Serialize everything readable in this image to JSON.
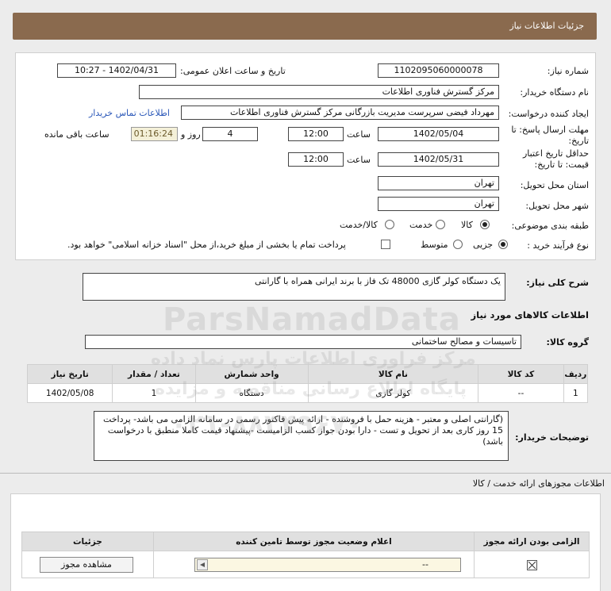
{
  "header": {
    "title": "جزئیات اطلاعات نیاز"
  },
  "form": {
    "need_number_label": "شماره نیاز:",
    "need_number": "1102095060000078",
    "announce_label": "تاریخ و ساعت اعلان عمومی:",
    "announce_value": "1402/04/31 - 10:27",
    "buyer_org_label": "نام دستگاه خریدار:",
    "buyer_org": "مرکز گسترش فناوری اطلاعات",
    "requester_label": "ایجاد کننده درخواست:",
    "requester": "مهرداد فیضی سرپرست مدیریت بازرگانی مرکز گسترش فناوری اطلاعات",
    "contact_link": "اطلاعات تماس خریدار",
    "deadline_label_1": "مهلت ارسال پاسخ: تا",
    "deadline_label_2": "تاریخ:",
    "deadline_date": "1402/05/04",
    "time_label": "ساعت",
    "deadline_time": "12:00",
    "day_label": "روز و",
    "days": "4",
    "remaining_time": "01:16:24",
    "remaining_label": "ساعت باقی مانده",
    "validity_label_1": "حداقل تاریخ اعتبار",
    "validity_label_2": "قیمت: تا تاریخ:",
    "validity_date": "1402/05/31",
    "validity_time": "12:00",
    "province_label": "استان محل تحویل:",
    "province": "تهران",
    "city_label": "شهر محل تحویل:",
    "city": "تهران",
    "category_label": "طبقه بندی موضوعی:",
    "category_options": [
      "کالا",
      "خدمت",
      "کالا/خدمت"
    ],
    "category_selected": "کالا",
    "process_label": "نوع فرآیند خرید :",
    "process_options": [
      "جزیی",
      "متوسط"
    ],
    "process_selected": "جزیی",
    "treasury_note": "پرداخت تمام یا بخشی از مبلغ خرید،از محل \"اسناد خزانه اسلامی\" خواهد بود."
  },
  "description": {
    "label": "شرح کلی نیاز:",
    "value": "یک دستگاه کولر گازی 48000 تک فاز با برند ایرانی همراه با گارانتی"
  },
  "goods_section": {
    "title": "اطلاعات کالاهای مورد نیاز"
  },
  "goods_group": {
    "label": "گروه کالا:",
    "value": "تاسیسات و مصالح ساختمانی"
  },
  "goods_table": {
    "headers": [
      "ردیف",
      "کد کالا",
      "نام کالا",
      "واحد شمارش",
      "تعداد / مقدار",
      "تاریخ نیاز"
    ],
    "rows": [
      [
        "1",
        "--",
        "کولر گازی",
        "دستگاه",
        "1",
        "1402/05/08"
      ]
    ]
  },
  "buyer_notes": {
    "label": "توضیحات خریدار:",
    "value": "(گارانتی اصلی و معتبر - هزینه حمل با فروشنده - ارائه پیش فاکتور رسمی در سامانه الزامی می باشد- پرداخت 15 روز کاری بعد از تحویل و تست - دارا بودن جواز کسب الزامیست -پیشنهاد قیمت کاملا منطبق با درخواست باشد)"
  },
  "licenses": {
    "title": "اطلاعات مجوزهای ارائه خدمت / کالا",
    "headers": [
      "الزامی بودن ارائه مجوز",
      "اعلام وضعیت مجوز توسط تامین کننده",
      "جزئیات"
    ],
    "status_value": "--",
    "view_button": "مشاهده مجوز"
  },
  "watermark": {
    "brand": "ParsNamadData",
    "line1": "مرکز فراوری اطلاعات پارس نماد داده",
    "line2": "پایگاه اطلاع رسانی مناقصه و مزایده",
    "phone": "۰۲۱-۸۸۳۴۹۶۷۰"
  }
}
